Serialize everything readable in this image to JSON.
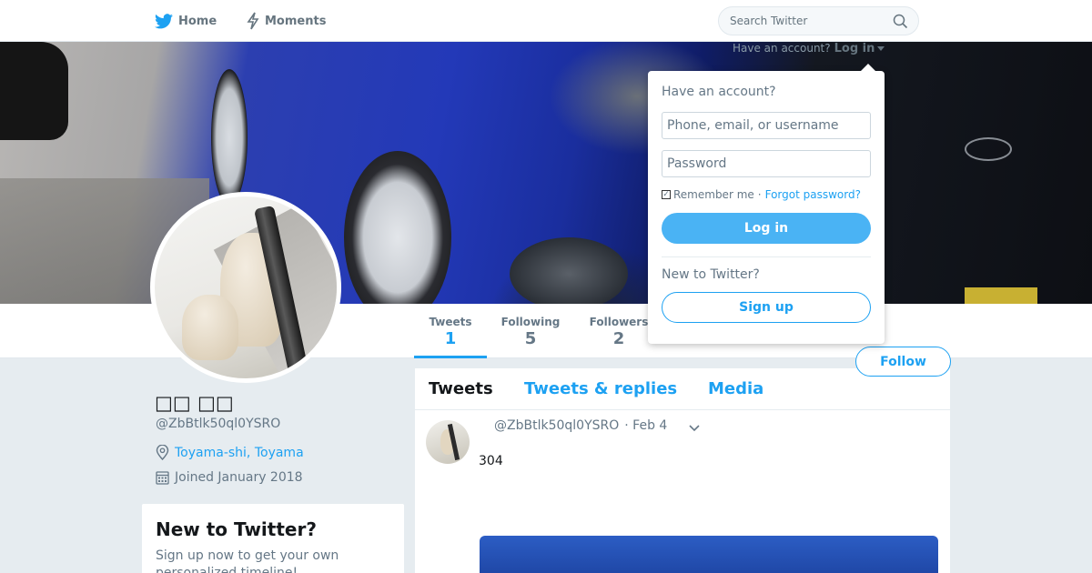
{
  "nav": {
    "home_label": "Home",
    "moments_label": "Moments",
    "search_placeholder": "Search Twitter",
    "icons": {
      "home": "bird-icon",
      "moments": "lightning-icon",
      "search": "magnifier-icon"
    }
  },
  "account_prompt": {
    "text": "Have an account?",
    "login_link": "Log in"
  },
  "login_dropdown": {
    "heading": "Have an account?",
    "username_placeholder": "Phone, email, or username",
    "password_placeholder": "Password",
    "remember_label": "Remember me",
    "separator": "·",
    "forgot_label": "Forgot password?",
    "login_button": "Log in",
    "new_heading": "New to Twitter?",
    "signup_button": "Sign up"
  },
  "stats": [
    {
      "label": "Tweets",
      "value": "1"
    },
    {
      "label": "Following",
      "value": "5"
    },
    {
      "label": "Followers",
      "value": "2"
    }
  ],
  "follow_button": "Follow",
  "profile": {
    "name": "□□ □□",
    "handle": "@ZbBtlk50ql0YSRO",
    "location": "Toyama-shi, Toyama",
    "joined": "Joined January 2018"
  },
  "new_to_twitter": {
    "title": "New to Twitter?",
    "text": "Sign up now to get your own personalized timeline!"
  },
  "timeline": {
    "tabs": [
      "Tweets",
      "Tweets & replies",
      "Media"
    ],
    "tweet": {
      "handle": "@ZbBtlk50ql0YSRO",
      "date": "· Feb 4",
      "text": "304"
    }
  },
  "colors": {
    "accent": "#1da1f2",
    "background": "#e6ecf0",
    "text_secondary": "#657786"
  }
}
